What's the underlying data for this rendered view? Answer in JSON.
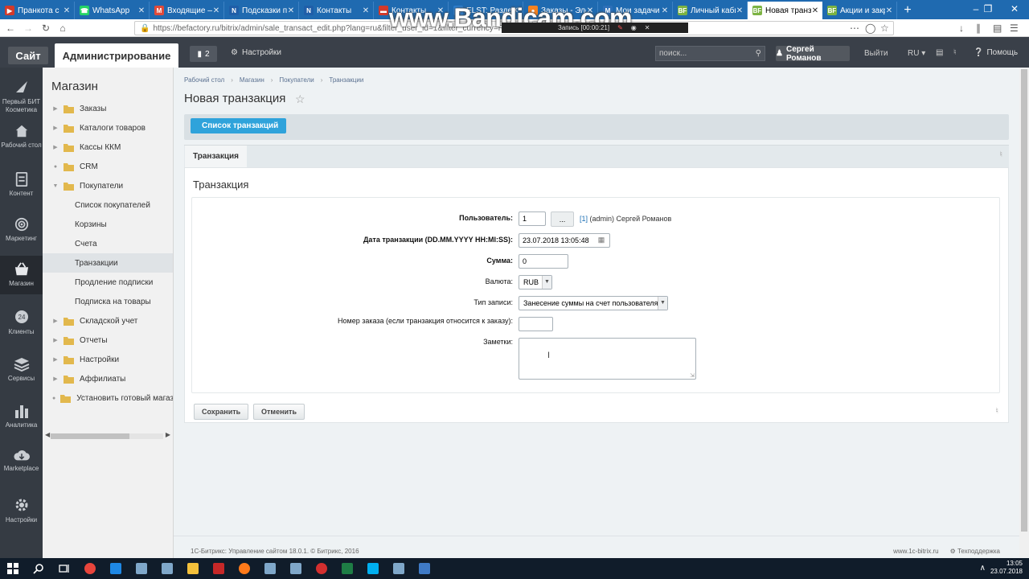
{
  "browser": {
    "tabs": [
      {
        "title": "Пранкота с",
        "favicon_color": "#d23a2b",
        "favicon_char": "▶"
      },
      {
        "title": "WhatsApp",
        "favicon_color": "#25d366",
        "favicon_char": "☎"
      },
      {
        "title": "Входящие — R",
        "favicon_color": "#e04a3a",
        "favicon_char": "M"
      },
      {
        "title": "Подсказки по",
        "favicon_color": "#1f5ea8",
        "favicon_char": "N"
      },
      {
        "title": "Контакты",
        "favicon_color": "#1f5ea8",
        "favicon_char": "N"
      },
      {
        "title": "Контакты",
        "favicon_color": "#d23a2b",
        "favicon_char": "▬"
      },
      {
        "title": "ELST: Раздели",
        "favicon_color": "#2d7fd0",
        "favicon_char": "E"
      },
      {
        "title": "Заказы - Элек",
        "favicon_color": "#f58220",
        "favicon_char": "●"
      },
      {
        "title": "Мои задачи",
        "favicon_color": "#2d6fb8",
        "favicon_char": "M"
      },
      {
        "title": "Личный кабин",
        "favicon_color": "#7cb342",
        "favicon_char": "BF"
      },
      {
        "title": "Новая транзакц",
        "favicon_color": "#7cb342",
        "favicon_char": "BF",
        "active": true
      },
      {
        "title": "Акции и закры",
        "favicon_color": "#7cb342",
        "favicon_char": "BF"
      }
    ],
    "url": "https://befactory.ru/bitrix/admin/sale_transact_edit.php?lang=ru&filter_user_id=1&filter_currency=RUB",
    "overlay_watermark": "www.Bandicam.com",
    "recorder_label": "Запись [00:00:21]"
  },
  "panel": {
    "site_label": "Сайт",
    "admin_label": "Администрирование",
    "notifications_count": "2",
    "settings_label": "Настройки",
    "search_placeholder": "поиск...",
    "user_name": "Сергей Романов",
    "logout_label": "Выйти",
    "lang_label": "RU",
    "help_label": "Помощь"
  },
  "iconcol": [
    {
      "label": "Первый БИТ Косметика",
      "icon": "logo-icon"
    },
    {
      "label": "Рабочий стол",
      "icon": "desktop-icon"
    },
    {
      "label": "Контент",
      "icon": "content-icon"
    },
    {
      "label": "Маркетинг",
      "icon": "marketing-icon"
    },
    {
      "label": "Магазин",
      "icon": "shop-icon",
      "active": true
    },
    {
      "label": "Клиенты",
      "icon": "clients-icon"
    },
    {
      "label": "Сервисы",
      "icon": "services-icon"
    },
    {
      "label": "Аналитика",
      "icon": "analytics-icon"
    },
    {
      "label": "Marketplace",
      "icon": "marketplace-icon"
    },
    {
      "label": "Настройки",
      "icon": "settings-icon"
    }
  ],
  "menu": {
    "title": "Магазин",
    "items": [
      {
        "label": "Заказы",
        "level": 0,
        "expand": "collapsed",
        "icon": "folder-icon"
      },
      {
        "label": "Каталоги товаров",
        "level": 0,
        "expand": "collapsed",
        "icon": "folder-icon"
      },
      {
        "label": "Кассы ККМ",
        "level": 0,
        "expand": "collapsed",
        "icon": "folder-icon"
      },
      {
        "label": "CRM",
        "level": 0,
        "expand": "none",
        "icon": "folder-icon"
      },
      {
        "label": "Покупатели",
        "level": 0,
        "expand": "expanded",
        "icon": "folder-icon"
      },
      {
        "label": "Список покупателей",
        "level": 1
      },
      {
        "label": "Корзины",
        "level": 1
      },
      {
        "label": "Счета",
        "level": 1
      },
      {
        "label": "Транзакции",
        "level": 1,
        "selected": true
      },
      {
        "label": "Продление подписки",
        "level": 1
      },
      {
        "label": "Подписка на товары",
        "level": 1
      },
      {
        "label": "Складской учет",
        "level": 0,
        "expand": "collapsed",
        "icon": "folder-icon"
      },
      {
        "label": "Отчеты",
        "level": 0,
        "expand": "collapsed",
        "icon": "folder-icon"
      },
      {
        "label": "Настройки",
        "level": 0,
        "expand": "collapsed",
        "icon": "folder-icon"
      },
      {
        "label": "Аффилиаты",
        "level": 0,
        "expand": "collapsed",
        "icon": "folder-icon"
      },
      {
        "label": "Установить готовый магазин из",
        "level": 0,
        "expand": "none",
        "icon": "folder-icon"
      }
    ]
  },
  "content": {
    "breadcrumb": [
      "Рабочий стол",
      "Магазин",
      "Покупатели",
      "Транзакции"
    ],
    "page_title": "Новая транзакция",
    "list_button": "Список транзакций",
    "tab_label": "Транзакция",
    "form_title": "Транзакция",
    "fields": {
      "user_label": "Пользователь:",
      "user_value": "1",
      "user_button": "...",
      "user_link_id": "[1]",
      "user_link_text": "(admin) Сергей Романов",
      "date_label": "Дата транзакции (DD.MM.YYYY HH:MI:SS):",
      "date_value": "23.07.2018 13:05:48",
      "sum_label": "Сумма:",
      "sum_value": "0",
      "currency_label": "Валюта:",
      "currency_value": "RUB",
      "type_label": "Тип записи:",
      "type_value": "Занесение суммы на счет пользователя",
      "order_label": "Номер заказа (если транзакция относится к заказу):",
      "order_value": "",
      "notes_label": "Заметки:",
      "notes_value": ""
    },
    "save_label": "Сохранить",
    "cancel_label": "Отменить"
  },
  "footer": {
    "left": "1С-Битрикс: Управление сайтом 18.0.1. © Битрикс, 2016",
    "site_link": "www.1c-bitrix.ru",
    "support_link": "Техподдержка"
  },
  "taskbar": {
    "time": "13:05",
    "date": "23.07.2018",
    "apps": [
      "start-icon",
      "search-icon",
      "task-view-icon",
      "chrome-icon",
      "edge-icon",
      "app-icon",
      "app-icon",
      "explorer-icon",
      "filezilla-icon",
      "firefox-icon",
      "app-icon",
      "app-icon",
      "bandicam-icon",
      "excel-icon",
      "skype-icon",
      "app-icon",
      "photos-icon"
    ]
  }
}
